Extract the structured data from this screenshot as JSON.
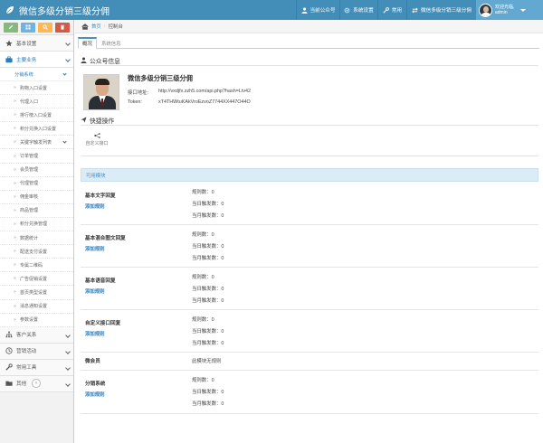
{
  "header": {
    "title": "微信多级分销三级分佣",
    "nav": [
      "当前公众号",
      "系统设置",
      "常用",
      "微信多级分销三级分佣"
    ],
    "user": {
      "greeting": "欢迎光临,",
      "name": "admin"
    }
  },
  "sidebar": {
    "shortcut_colors": [
      "#87b87f",
      "#6fb3e0",
      "#ffb752",
      "#d15b47"
    ],
    "items_top": [
      {
        "label": "基本设置",
        "icon": "star-icon",
        "active": false
      },
      {
        "label": "主要业务",
        "icon": "briefcase-icon",
        "active": true
      }
    ],
    "sub_head": "分销系统",
    "sub_items": [
      "购物入口设置",
      "代理入口",
      "排行榜入口设置",
      "积分兑换入口设置",
      "关键字触发列表",
      "订单管理",
      "会员管理",
      "代理管理",
      "佣金审核",
      "商品管理",
      "积分兑换管理",
      "数据统计",
      "配送支付设置",
      "专属二维码",
      "广告促销设置",
      "首页类型设置",
      "消息通知设置",
      "参数设置"
    ],
    "items_bottom": [
      {
        "label": "客户关系",
        "icon": "sitemap-icon"
      },
      {
        "label": "营销活动",
        "icon": "clock-icon"
      },
      {
        "label": "常用工具",
        "icon": "wrench-icon"
      },
      {
        "label": "其他",
        "icon": "folder-icon"
      }
    ],
    "collapse_glyph": "«"
  },
  "breadcrumb": {
    "home": "首页",
    "current": "控制台"
  },
  "tabs": [
    "概况",
    "系统信息"
  ],
  "account": {
    "section_title": "公众号信息",
    "name": "微信多级分销三级分佣",
    "api_label": "接口地址:",
    "api_value": "http://vxdjfx.zzh5.com/api.php?hash=Ltv42",
    "token_label": "Token:",
    "token_value": "xT4THWtuKAkVroEzvoZ7744XX447O44O"
  },
  "quick": {
    "title": "快捷操作",
    "item_label": "自定义接口"
  },
  "modules": {
    "header": "可用模块",
    "list": [
      {
        "name": "基本文字回复",
        "add": "添加规则",
        "stats": [
          "规则数：0",
          "当日触发数：0",
          "当月触发数：0"
        ]
      },
      {
        "name": "基本混合图文回复",
        "add": "添加规则",
        "stats": [
          "规则数：0",
          "当日触发数：0",
          "当月触发数：0"
        ]
      },
      {
        "name": "基本语音回复",
        "add": "添加规则",
        "stats": [
          "规则数：0",
          "当日触发数：0",
          "当月触发数：0"
        ]
      },
      {
        "name": "自定义接口回复",
        "add": "添加规则",
        "stats": [
          "规则数：0",
          "当日触发数：0",
          "当月触发数：0"
        ]
      },
      {
        "name": "微会员",
        "add": "",
        "stats": [
          "此模块无规则"
        ]
      },
      {
        "name": "分销系统",
        "add": "添加规则",
        "stats": [
          "规则数：0",
          "当日触发数：0",
          "当月触发数：0"
        ]
      }
    ]
  }
}
